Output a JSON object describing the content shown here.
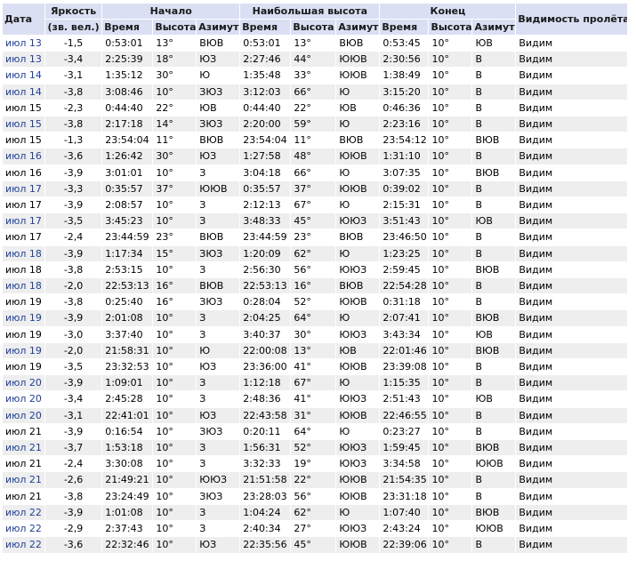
{
  "headers": {
    "date": "Дата",
    "magnitude_line1": "Яркость",
    "magnitude_line2": "(зв. вел.)",
    "start": "Начало",
    "highest": "Наибольшая высота",
    "end": "Конец",
    "visibility": "Видимость пролёта",
    "sub_time": "Время",
    "sub_alt": "Высота",
    "sub_az": "Азимут"
  },
  "rows": [
    {
      "date": "июл 13",
      "link": true,
      "mag": "-1,5",
      "s_time": "0:53:01",
      "s_alt": "13°",
      "s_az": "ВЮВ",
      "h_time": "0:53:01",
      "h_alt": "13°",
      "h_az": "ВЮВ",
      "e_time": "0:53:45",
      "e_alt": "10°",
      "e_az": "ЮВ",
      "vis": "Видим"
    },
    {
      "date": "июл 13",
      "link": true,
      "mag": "-3,4",
      "s_time": "2:25:39",
      "s_alt": "18°",
      "s_az": "ЮЗ",
      "h_time": "2:27:46",
      "h_alt": "44°",
      "h_az": "ЮЮВ",
      "e_time": "2:30:56",
      "e_alt": "10°",
      "e_az": "В",
      "vis": "Видим"
    },
    {
      "date": "июл 14",
      "link": true,
      "mag": "-3,1",
      "s_time": "1:35:12",
      "s_alt": "30°",
      "s_az": "Ю",
      "h_time": "1:35:48",
      "h_alt": "33°",
      "h_az": "ЮЮВ",
      "e_time": "1:38:49",
      "e_alt": "10°",
      "e_az": "В",
      "vis": "Видим"
    },
    {
      "date": "июл 14",
      "link": true,
      "mag": "-3,8",
      "s_time": "3:08:46",
      "s_alt": "10°",
      "s_az": "ЗЮЗ",
      "h_time": "3:12:03",
      "h_alt": "66°",
      "h_az": "Ю",
      "e_time": "3:15:20",
      "e_alt": "10°",
      "e_az": "В",
      "vis": "Видим"
    },
    {
      "date": "июл 15",
      "link": false,
      "mag": "-2,3",
      "s_time": "0:44:40",
      "s_alt": "22°",
      "s_az": "ЮВ",
      "h_time": "0:44:40",
      "h_alt": "22°",
      "h_az": "ЮВ",
      "e_time": "0:46:36",
      "e_alt": "10°",
      "e_az": "В",
      "vis": "Видим"
    },
    {
      "date": "июл 15",
      "link": true,
      "mag": "-3,8",
      "s_time": "2:17:18",
      "s_alt": "14°",
      "s_az": "ЗЮЗ",
      "h_time": "2:20:00",
      "h_alt": "59°",
      "h_az": "Ю",
      "e_time": "2:23:16",
      "e_alt": "10°",
      "e_az": "В",
      "vis": "Видим"
    },
    {
      "date": "июл 15",
      "link": false,
      "mag": "-1,3",
      "s_time": "23:54:04",
      "s_alt": "11°",
      "s_az": "ВЮВ",
      "h_time": "23:54:04",
      "h_alt": "11°",
      "h_az": "ВЮВ",
      "e_time": "23:54:12",
      "e_alt": "10°",
      "e_az": "ВЮВ",
      "vis": "Видим"
    },
    {
      "date": "июл 16",
      "link": true,
      "mag": "-3,6",
      "s_time": "1:26:42",
      "s_alt": "30°",
      "s_az": "ЮЗ",
      "h_time": "1:27:58",
      "h_alt": "48°",
      "h_az": "ЮЮВ",
      "e_time": "1:31:10",
      "e_alt": "10°",
      "e_az": "В",
      "vis": "Видим"
    },
    {
      "date": "июл 16",
      "link": false,
      "mag": "-3,9",
      "s_time": "3:01:01",
      "s_alt": "10°",
      "s_az": "З",
      "h_time": "3:04:18",
      "h_alt": "66°",
      "h_az": "Ю",
      "e_time": "3:07:35",
      "e_alt": "10°",
      "e_az": "ВЮВ",
      "vis": "Видим"
    },
    {
      "date": "июл 17",
      "link": true,
      "mag": "-3,3",
      "s_time": "0:35:57",
      "s_alt": "37°",
      "s_az": "ЮЮВ",
      "h_time": "0:35:57",
      "h_alt": "37°",
      "h_az": "ЮЮВ",
      "e_time": "0:39:02",
      "e_alt": "10°",
      "e_az": "В",
      "vis": "Видим"
    },
    {
      "date": "июл 17",
      "link": false,
      "mag": "-3,9",
      "s_time": "2:08:57",
      "s_alt": "10°",
      "s_az": "З",
      "h_time": "2:12:13",
      "h_alt": "67°",
      "h_az": "Ю",
      "e_time": "2:15:31",
      "e_alt": "10°",
      "e_az": "В",
      "vis": "Видим"
    },
    {
      "date": "июл 17",
      "link": true,
      "mag": "-3,5",
      "s_time": "3:45:23",
      "s_alt": "10°",
      "s_az": "З",
      "h_time": "3:48:33",
      "h_alt": "45°",
      "h_az": "ЮЮЗ",
      "e_time": "3:51:43",
      "e_alt": "10°",
      "e_az": "ЮВ",
      "vis": "Видим"
    },
    {
      "date": "июл 17",
      "link": false,
      "mag": "-2,4",
      "s_time": "23:44:59",
      "s_alt": "23°",
      "s_az": "ВЮВ",
      "h_time": "23:44:59",
      "h_alt": "23°",
      "h_az": "ВЮВ",
      "e_time": "23:46:50",
      "e_alt": "10°",
      "e_az": "В",
      "vis": "Видим"
    },
    {
      "date": "июл 18",
      "link": true,
      "mag": "-3,9",
      "s_time": "1:17:34",
      "s_alt": "15°",
      "s_az": "ЗЮЗ",
      "h_time": "1:20:09",
      "h_alt": "62°",
      "h_az": "Ю",
      "e_time": "1:23:25",
      "e_alt": "10°",
      "e_az": "В",
      "vis": "Видим"
    },
    {
      "date": "июл 18",
      "link": false,
      "mag": "-3,8",
      "s_time": "2:53:15",
      "s_alt": "10°",
      "s_az": "З",
      "h_time": "2:56:30",
      "h_alt": "56°",
      "h_az": "ЮЮЗ",
      "e_time": "2:59:45",
      "e_alt": "10°",
      "e_az": "ВЮВ",
      "vis": "Видим"
    },
    {
      "date": "июл 18",
      "link": true,
      "mag": "-2,0",
      "s_time": "22:53:13",
      "s_alt": "16°",
      "s_az": "ВЮВ",
      "h_time": "22:53:13",
      "h_alt": "16°",
      "h_az": "ВЮВ",
      "e_time": "22:54:28",
      "e_alt": "10°",
      "e_az": "В",
      "vis": "Видим"
    },
    {
      "date": "июл 19",
      "link": false,
      "mag": "-3,8",
      "s_time": "0:25:40",
      "s_alt": "16°",
      "s_az": "ЗЮЗ",
      "h_time": "0:28:04",
      "h_alt": "52°",
      "h_az": "ЮЮВ",
      "e_time": "0:31:18",
      "e_alt": "10°",
      "e_az": "В",
      "vis": "Видим"
    },
    {
      "date": "июл 19",
      "link": true,
      "mag": "-3,9",
      "s_time": "2:01:08",
      "s_alt": "10°",
      "s_az": "З",
      "h_time": "2:04:25",
      "h_alt": "64°",
      "h_az": "Ю",
      "e_time": "2:07:41",
      "e_alt": "10°",
      "e_az": "ВЮВ",
      "vis": "Видим"
    },
    {
      "date": "июл 19",
      "link": false,
      "mag": "-3,0",
      "s_time": "3:37:40",
      "s_alt": "10°",
      "s_az": "З",
      "h_time": "3:40:37",
      "h_alt": "30°",
      "h_az": "ЮЮЗ",
      "e_time": "3:43:34",
      "e_alt": "10°",
      "e_az": "ЮВ",
      "vis": "Видим"
    },
    {
      "date": "июл 19",
      "link": true,
      "mag": "-2,0",
      "s_time": "21:58:31",
      "s_alt": "10°",
      "s_az": "Ю",
      "h_time": "22:00:08",
      "h_alt": "13°",
      "h_az": "ЮВ",
      "e_time": "22:01:46",
      "e_alt": "10°",
      "e_az": "ВЮВ",
      "vis": "Видим"
    },
    {
      "date": "июл 19",
      "link": false,
      "mag": "-3,5",
      "s_time": "23:32:53",
      "s_alt": "10°",
      "s_az": "ЮЗ",
      "h_time": "23:36:00",
      "h_alt": "41°",
      "h_az": "ЮЮВ",
      "e_time": "23:39:08",
      "e_alt": "10°",
      "e_az": "В",
      "vis": "Видим"
    },
    {
      "date": "июл 20",
      "link": true,
      "mag": "-3,9",
      "s_time": "1:09:01",
      "s_alt": "10°",
      "s_az": "З",
      "h_time": "1:12:18",
      "h_alt": "67°",
      "h_az": "Ю",
      "e_time": "1:15:35",
      "e_alt": "10°",
      "e_az": "В",
      "vis": "Видим"
    },
    {
      "date": "июл 20",
      "link": true,
      "mag": "-3,4",
      "s_time": "2:45:28",
      "s_alt": "10°",
      "s_az": "З",
      "h_time": "2:48:36",
      "h_alt": "41°",
      "h_az": "ЮЮЗ",
      "e_time": "2:51:43",
      "e_alt": "10°",
      "e_az": "ЮВ",
      "vis": "Видим"
    },
    {
      "date": "июл 20",
      "link": true,
      "mag": "-3,1",
      "s_time": "22:41:01",
      "s_alt": "10°",
      "s_az": "ЮЗ",
      "h_time": "22:43:58",
      "h_alt": "31°",
      "h_az": "ЮЮВ",
      "e_time": "22:46:55",
      "e_alt": "10°",
      "e_az": "В",
      "vis": "Видим"
    },
    {
      "date": "июл 21",
      "link": false,
      "mag": "-3,9",
      "s_time": "0:16:54",
      "s_alt": "10°",
      "s_az": "ЗЮЗ",
      "h_time": "0:20:11",
      "h_alt": "64°",
      "h_az": "Ю",
      "e_time": "0:23:27",
      "e_alt": "10°",
      "e_az": "В",
      "vis": "Видим"
    },
    {
      "date": "июл 21",
      "link": true,
      "mag": "-3,7",
      "s_time": "1:53:18",
      "s_alt": "10°",
      "s_az": "З",
      "h_time": "1:56:31",
      "h_alt": "52°",
      "h_az": "ЮЮЗ",
      "e_time": "1:59:45",
      "e_alt": "10°",
      "e_az": "ВЮВ",
      "vis": "Видим"
    },
    {
      "date": "июл 21",
      "link": false,
      "mag": "-2,4",
      "s_time": "3:30:08",
      "s_alt": "10°",
      "s_az": "З",
      "h_time": "3:32:33",
      "h_alt": "19°",
      "h_az": "ЮЮЗ",
      "e_time": "3:34:58",
      "e_alt": "10°",
      "e_az": "ЮЮВ",
      "vis": "Видим"
    },
    {
      "date": "июл 21",
      "link": true,
      "mag": "-2,6",
      "s_time": "21:49:21",
      "s_alt": "10°",
      "s_az": "ЮЮЗ",
      "h_time": "21:51:58",
      "h_alt": "22°",
      "h_az": "ЮЮВ",
      "e_time": "21:54:35",
      "e_alt": "10°",
      "e_az": "В",
      "vis": "Видим"
    },
    {
      "date": "июл 21",
      "link": false,
      "mag": "-3,8",
      "s_time": "23:24:49",
      "s_alt": "10°",
      "s_az": "ЗЮЗ",
      "h_time": "23:28:03",
      "h_alt": "56°",
      "h_az": "ЮЮВ",
      "e_time": "23:31:18",
      "e_alt": "10°",
      "e_az": "В",
      "vis": "Видим"
    },
    {
      "date": "июл 22",
      "link": true,
      "mag": "-3,9",
      "s_time": "1:01:08",
      "s_alt": "10°",
      "s_az": "З",
      "h_time": "1:04:24",
      "h_alt": "62°",
      "h_az": "Ю",
      "e_time": "1:07:40",
      "e_alt": "10°",
      "e_az": "ВЮВ",
      "vis": "Видим"
    },
    {
      "date": "июл 22",
      "link": true,
      "mag": "-2,9",
      "s_time": "2:37:43",
      "s_alt": "10°",
      "s_az": "З",
      "h_time": "2:40:34",
      "h_alt": "27°",
      "h_az": "ЮЮЗ",
      "e_time": "2:43:24",
      "e_alt": "10°",
      "e_az": "ЮЮВ",
      "vis": "Видим"
    },
    {
      "date": "июл 22",
      "link": true,
      "mag": "-3,6",
      "s_time": "22:32:46",
      "s_alt": "10°",
      "s_az": "ЮЗ",
      "h_time": "22:35:56",
      "h_alt": "45°",
      "h_az": "ЮЮВ",
      "e_time": "22:39:06",
      "e_alt": "10°",
      "e_az": "В",
      "vis": "Видим"
    }
  ]
}
